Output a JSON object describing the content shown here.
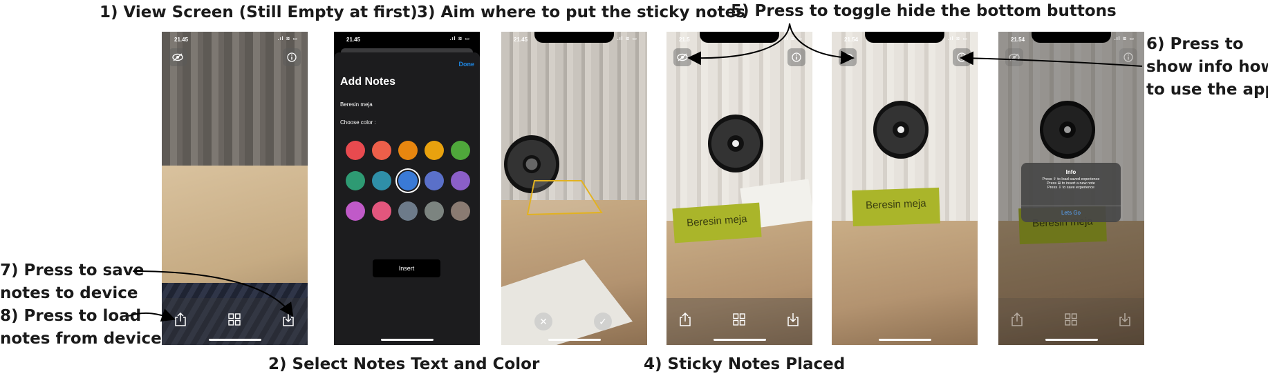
{
  "captions": {
    "c1": "1) View Screen (Still Empty at first)",
    "c2": "2)  Select Notes Text and Color",
    "c3": "3) Aim where to put the sticky notes",
    "c4": "4) Sticky Notes Placed",
    "c5": "5) Press to toggle hide the bottom buttons",
    "c6_line1": "6) Press to",
    "c6_line2": "show info how",
    "c6_line3": "to use the app",
    "c7_line1": "7) Press  to save",
    "c7_line2": "notes to device",
    "c8_line1": "8) Press to load",
    "c8_line2": "notes from device"
  },
  "screens": {
    "s1": {
      "time": "21.45"
    },
    "s2": {
      "time": "21.45",
      "done_label": "Done",
      "title": "Add Notes",
      "note_text": "Beresin meja",
      "choose_color_label": "Choose color :",
      "insert_label": "Insert",
      "colors": [
        "#e84a4f",
        "#ed5f4a",
        "#e8860f",
        "#e9a20e",
        "#4fa83b",
        "#2e9a73",
        "#2f8fa8",
        "#3a7ad6",
        "#5a70c9",
        "#8b5fc8",
        "#c05ac8",
        "#e3567d",
        "#6d7b8a",
        "#7c8480",
        "#8a7b72"
      ],
      "selected_color": "#3a7ad6"
    },
    "s3": {
      "time": "21.45"
    },
    "s4": {
      "time": "21.5",
      "note_text": "Beresin meja"
    },
    "s5": {
      "time": "21.54",
      "note_text": "Beresin meja"
    },
    "s6": {
      "time": "21.54",
      "note_text": "Beresin meja",
      "info_title": "Info",
      "info_line1": "Press ⇧ to load saved experience",
      "info_line2": "Press ⊞ to insert a new note",
      "info_line3": "Press ⇩ to save experience",
      "info_button": "Lets Go"
    }
  },
  "colors": {
    "accent_blue": "#1e88e5",
    "note_green": "#aab52a"
  }
}
